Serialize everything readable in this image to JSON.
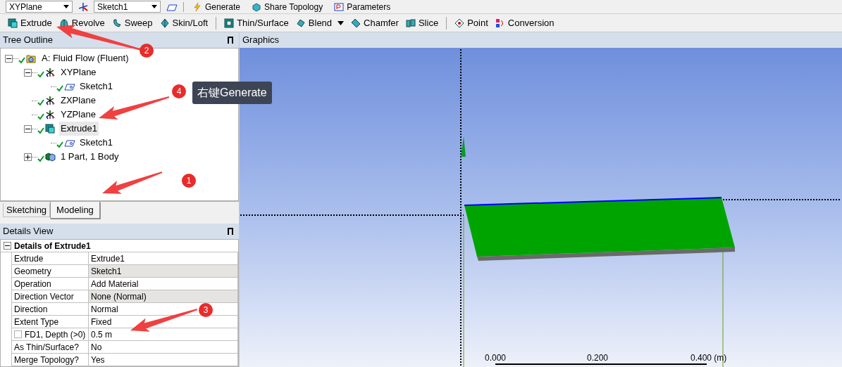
{
  "top_toolbar": {
    "plane_dropdown": "XYPlane",
    "sketch_dropdown": "Sketch1",
    "buttons": [
      {
        "label": "Generate",
        "kind": "generate"
      },
      {
        "label": "Share Topology",
        "kind": "share"
      },
      {
        "label": "Parameters",
        "kind": "parameters"
      }
    ]
  },
  "feature_toolbar": [
    [
      {
        "label": "Extrude",
        "kind": "extrude",
        "dropdown": false
      },
      {
        "label": "Revolve",
        "kind": "revolve",
        "dropdown": false
      },
      {
        "label": "Sweep",
        "kind": "sweep",
        "dropdown": false
      },
      {
        "label": "Skin/Loft",
        "kind": "loft",
        "dropdown": false
      }
    ],
    [
      {
        "label": "Thin/Surface",
        "kind": "thin",
        "dropdown": false
      },
      {
        "label": "Blend",
        "kind": "blend",
        "dropdown": true
      },
      {
        "label": "Chamfer",
        "kind": "chamfer",
        "dropdown": false
      },
      {
        "label": "Slice",
        "kind": "slice",
        "dropdown": false
      }
    ],
    [
      {
        "label": "Point",
        "kind": "point",
        "dropdown": false
      },
      {
        "label": "Conversion",
        "kind": "conversion",
        "dropdown": false
      }
    ]
  ],
  "tree_outline": {
    "title": "Tree Outline",
    "items": [
      {
        "label": "A: Fluid Flow (Fluent)",
        "kind": "model",
        "expanded": true,
        "selected": false,
        "children": [
          {
            "label": "XYPlane",
            "kind": "plane",
            "expanded": true,
            "selected": false,
            "children": [
              {
                "label": "Sketch1",
                "kind": "sketch",
                "selected": false
              }
            ]
          },
          {
            "label": "ZXPlane",
            "kind": "plane",
            "selected": false
          },
          {
            "label": "YZPlane",
            "kind": "plane",
            "selected": false
          },
          {
            "label": "Extrude1",
            "kind": "extrude",
            "expanded": true,
            "selected": true,
            "children": [
              {
                "label": "Sketch1",
                "kind": "sketch",
                "selected": false
              }
            ]
          },
          {
            "label": "1 Part, 1 Body",
            "kind": "body",
            "expanded": false,
            "selected": false
          }
        ]
      }
    ]
  },
  "mode_tabs": [
    {
      "label": "Sketching",
      "selected": false
    },
    {
      "label": "Modeling",
      "selected": true
    }
  ],
  "details_view": {
    "title": "Details View",
    "heading": "Details of Extrude1",
    "rows": [
      {
        "label": "Extrude",
        "value": "Extrude1",
        "shaded": false
      },
      {
        "label": "Geometry",
        "value": "Sketch1",
        "shaded": true
      },
      {
        "label": "Operation",
        "value": "Add Material",
        "shaded": false
      },
      {
        "label": "Direction Vector",
        "value": "None (Normal)",
        "shaded": true
      },
      {
        "label": "Direction",
        "value": "Normal",
        "shaded": false
      },
      {
        "label": "Extent Type",
        "value": "Fixed",
        "shaded": false
      },
      {
        "label": "FD1,  Depth (>0)",
        "value": "0.5 m",
        "shaded": false,
        "checked": false
      },
      {
        "label": "As Thin/Surface?",
        "value": "No",
        "shaded": false
      },
      {
        "label": "Merge Topology?",
        "value": "Yes",
        "shaded": false
      }
    ]
  },
  "graphics": {
    "title": "Graphics",
    "scale_labels": [
      "0.000",
      "0.200",
      "0.400 (m)"
    ]
  },
  "annotations": [
    {
      "number": "1"
    },
    {
      "number": "2"
    },
    {
      "number": "3"
    },
    {
      "number": "4",
      "callout": "右键Generate"
    }
  ]
}
